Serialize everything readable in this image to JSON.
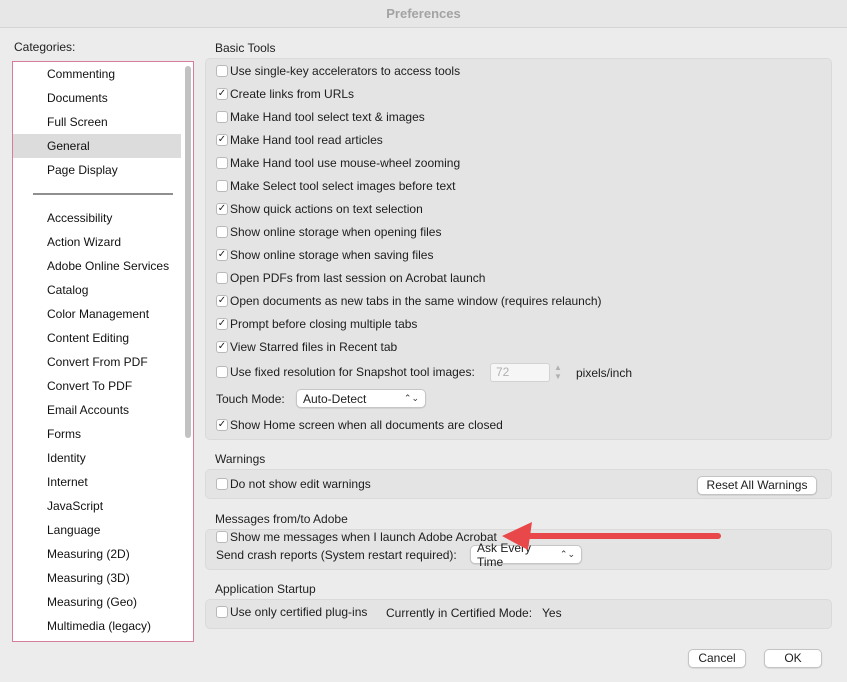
{
  "window": {
    "title": "Preferences"
  },
  "colors": {
    "accent_arrow": "#e8484a",
    "selected_row": "#dcdcdc",
    "list_border": "#d77c9b"
  },
  "categories": {
    "label": "Categories:",
    "group1": [
      "Commenting",
      "Documents",
      "Full Screen",
      "General",
      "Page Display"
    ],
    "group2": [
      "Accessibility",
      "Action Wizard",
      "Adobe Online Services",
      "Catalog",
      "Color Management",
      "Content Editing",
      "Convert From PDF",
      "Convert To PDF",
      "Email Accounts",
      "Forms",
      "Identity",
      "Internet",
      "JavaScript",
      "Language",
      "Measuring (2D)",
      "Measuring (3D)",
      "Measuring (Geo)",
      "Multimedia (legacy)"
    ],
    "selected": "General"
  },
  "basic_tools": {
    "title": "Basic Tools",
    "options": [
      {
        "label": "Use single-key accelerators to access tools",
        "checked": false
      },
      {
        "label": "Create links from URLs",
        "checked": true
      },
      {
        "label": "Make Hand tool select text & images",
        "checked": false
      },
      {
        "label": "Make Hand tool read articles",
        "checked": true
      },
      {
        "label": "Make Hand tool use mouse-wheel zooming",
        "checked": false
      },
      {
        "label": "Make Select tool select images before text",
        "checked": false
      },
      {
        "label": "Show quick actions on text selection",
        "checked": true
      },
      {
        "label": "Show online storage when opening files",
        "checked": false
      },
      {
        "label": "Show online storage when saving files",
        "checked": true
      },
      {
        "label": "Open PDFs from last session on Acrobat launch",
        "checked": false
      },
      {
        "label": "Open documents as new tabs in the same window (requires relaunch)",
        "checked": true
      },
      {
        "label": "Prompt before closing multiple tabs",
        "checked": true
      },
      {
        "label": "View Starred files in Recent tab",
        "checked": true
      }
    ],
    "snapshot": {
      "label": "Use fixed resolution for Snapshot tool images:",
      "checked": false,
      "value": "72",
      "unit": "pixels/inch"
    },
    "touch_mode": {
      "label": "Touch Mode:",
      "value": "Auto-Detect"
    },
    "home_screen": {
      "label": "Show Home screen when all documents are closed",
      "checked": true
    }
  },
  "warnings": {
    "title": "Warnings",
    "option": {
      "label": "Do not show edit warnings",
      "checked": false
    },
    "reset_button": "Reset All Warnings"
  },
  "messages": {
    "title": "Messages from/to Adobe",
    "option": {
      "label": "Show me messages when I launch Adobe Acrobat",
      "checked": false
    },
    "crash": {
      "label": "Send crash reports (System restart required):",
      "value": "Ask Every Time"
    }
  },
  "startup": {
    "title": "Application Startup",
    "option": {
      "label": "Use only certified plug-ins",
      "checked": false
    },
    "mode_label": "Currently in Certified Mode:",
    "mode_value": "Yes"
  },
  "footer": {
    "cancel": "Cancel",
    "ok": "OK"
  }
}
